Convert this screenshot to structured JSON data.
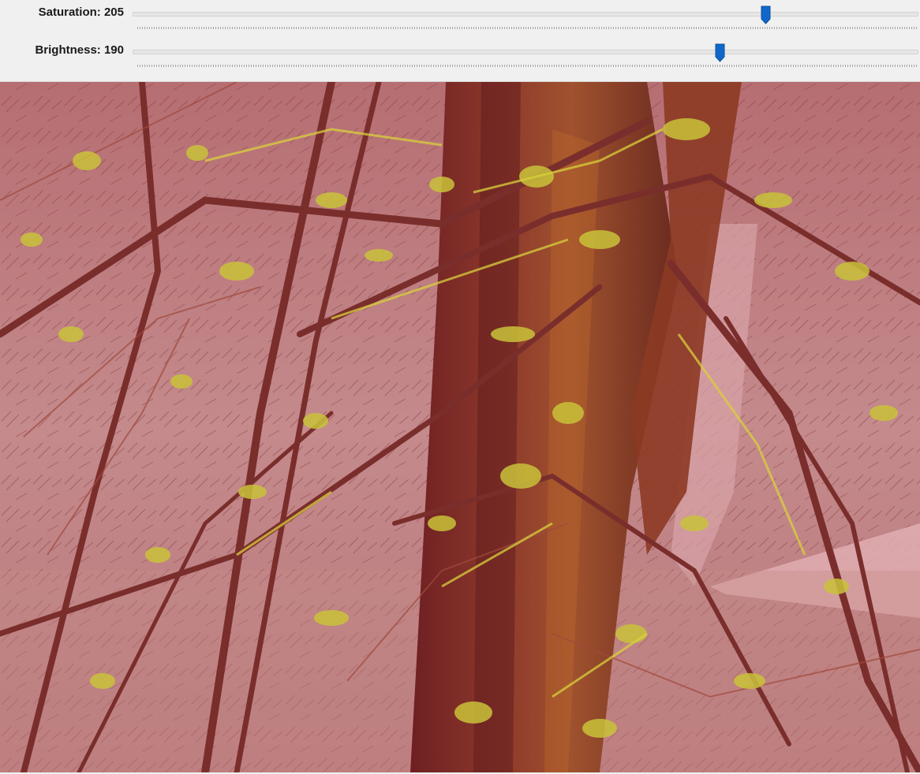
{
  "controls": {
    "saturation": {
      "label": "Saturation: 205",
      "value": 205,
      "max": 255
    },
    "brightness": {
      "label": "Brightness: 190",
      "value": 190,
      "max": 255
    }
  },
  "colors": {
    "thumb": "#1167c9",
    "panel": "#f0f0f0",
    "tint_pink": "#c98a90",
    "tint_dark": "#7a2a2e",
    "moss": "#c9c23a"
  },
  "image": {
    "subject": "moss-covered-conifer-tree",
    "tint": "red-pink"
  }
}
